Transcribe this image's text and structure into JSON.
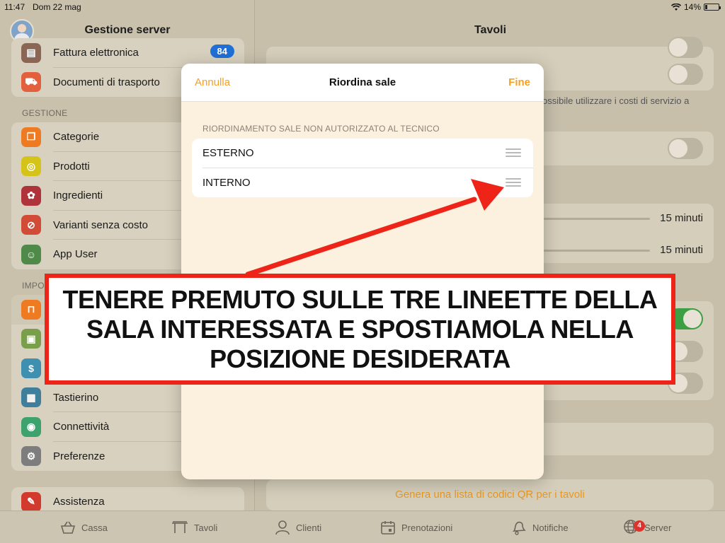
{
  "status_bar": {
    "time": "11:47",
    "date": "Dom 22 mag",
    "battery": "14%",
    "wifi_icon": "wifi-icon"
  },
  "left_pane": {
    "title": "Gestione server",
    "top_group": [
      {
        "label": "Fattura elettronica",
        "icon": "invoice-icon",
        "color": "#8b6655",
        "badge": "84"
      },
      {
        "label": "Documenti di trasporto",
        "icon": "truck-icon",
        "color": "#e3603f"
      }
    ],
    "section_gestione": "GESTIONE",
    "gestione_items": [
      {
        "label": "Categorie",
        "icon": "categories-icon",
        "color": "#ee7b22"
      },
      {
        "label": "Prodotti",
        "icon": "products-icon",
        "color": "#d5c31a"
      },
      {
        "label": "Ingredienti",
        "icon": "ingredients-icon",
        "color": "#b0323a"
      },
      {
        "label": "Varianti senza costo",
        "icon": "variants-icon",
        "color": "#d24b36"
      },
      {
        "label": "App User",
        "icon": "app-user-icon",
        "color": "#4f8a48"
      }
    ],
    "section_impostazioni": "IMPO",
    "impostazioni_items": [
      {
        "label": "",
        "icon": "table-icon",
        "color": "#ee7b22"
      },
      {
        "label": "",
        "icon": "register-icon",
        "color": "#7a9f4a"
      },
      {
        "label": "",
        "icon": "payment-icon",
        "color": "#3f8fb0"
      },
      {
        "label": "Tastierino",
        "icon": "keypad-icon",
        "color": "#3f7f9b"
      },
      {
        "label": "Connettività",
        "icon": "connectivity-icon",
        "color": "#3da36e"
      },
      {
        "label": "Preferenze",
        "icon": "preferences-icon",
        "color": "#7d7d7d"
      }
    ],
    "assistenza": {
      "label": "Assistenza",
      "icon": "support-icon",
      "color": "#d23a2e"
    }
  },
  "right_pane": {
    "title": "Tavoli",
    "partial_text": "ossibile utilizzare i costi di servizio a",
    "slider_1_value": "15 minuti",
    "slider_2_value": "15 minuti",
    "qr_link": "Genera una lista di codici QR per i tavoli"
  },
  "modal": {
    "cancel": "Annulla",
    "title": "Riordina sale",
    "done": "Fine",
    "hint": "RIORDINAMENTO SALE NON AUTORIZZATO AL TECNICO",
    "rooms": [
      "ESTERNO",
      "INTERNO"
    ]
  },
  "callout": {
    "text": "TENERE PREMUTO SULLE TRE LINEETTE DELLA SALA INTERESSATA E SPOSTIAMOLA NELLA POSIZIONE DESIDERATA"
  },
  "tab_bar": [
    {
      "label": "Cassa",
      "icon": "basket-icon"
    },
    {
      "label": "Tavoli",
      "icon": "table-icon"
    },
    {
      "label": "Clienti",
      "icon": "person-icon"
    },
    {
      "label": "Prenotazioni",
      "icon": "calendar-icon"
    },
    {
      "label": "Notifiche",
      "icon": "bell-icon"
    },
    {
      "label": "Server",
      "icon": "globe-icon",
      "badge": "4"
    }
  ],
  "colors": {
    "accent": "#f5a123",
    "toggle_on": "#3c9f43",
    "badge_blue": "#1f6fd6",
    "callout_border": "#ef2418"
  }
}
